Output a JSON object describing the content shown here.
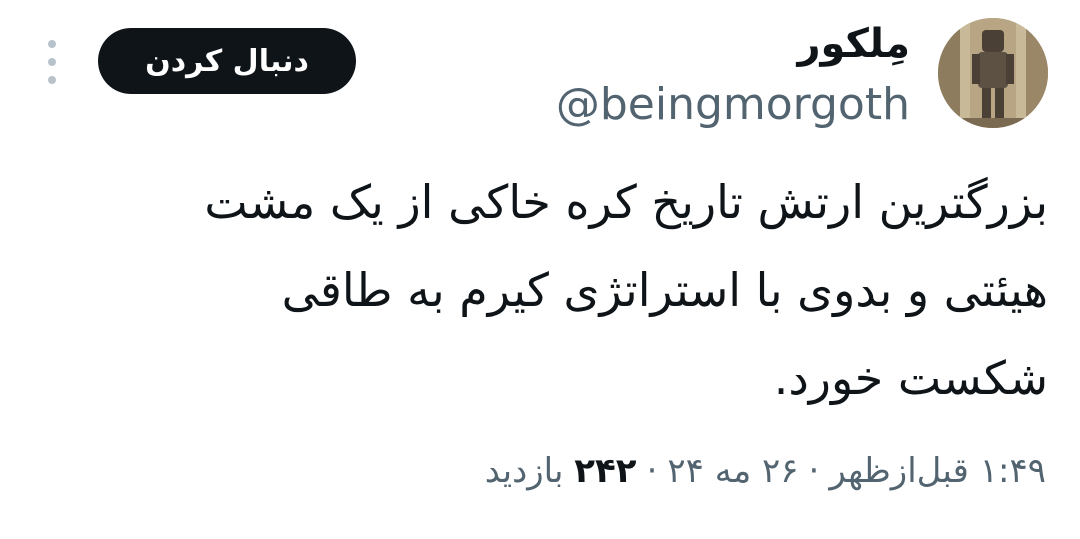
{
  "user": {
    "display_name": "مِلکور",
    "handle": "@beingmorgoth",
    "avatar_icon": "armored-figure-avatar"
  },
  "actions": {
    "follow_label": "دنبال کردن",
    "more_icon": "more-vertical-icon"
  },
  "tweet": {
    "lines": [
      "بزرگترین ارتش تاریخ کره خاکی از یک مشت",
      "هیئتی و بدوی با استراتژی کیرم به طاقی",
      "شکست خورد."
    ]
  },
  "meta": {
    "time": "۱:۴۹ قبل‌ازظهر",
    "separator": "·",
    "date": "۲۶ مه ۲۴",
    "views_count": "۲۴۲",
    "views_label": "بازدید"
  },
  "colors": {
    "text": "#0f1419",
    "secondary": "#536471",
    "button_bg": "#0f1419",
    "button_text": "#ffffff"
  }
}
